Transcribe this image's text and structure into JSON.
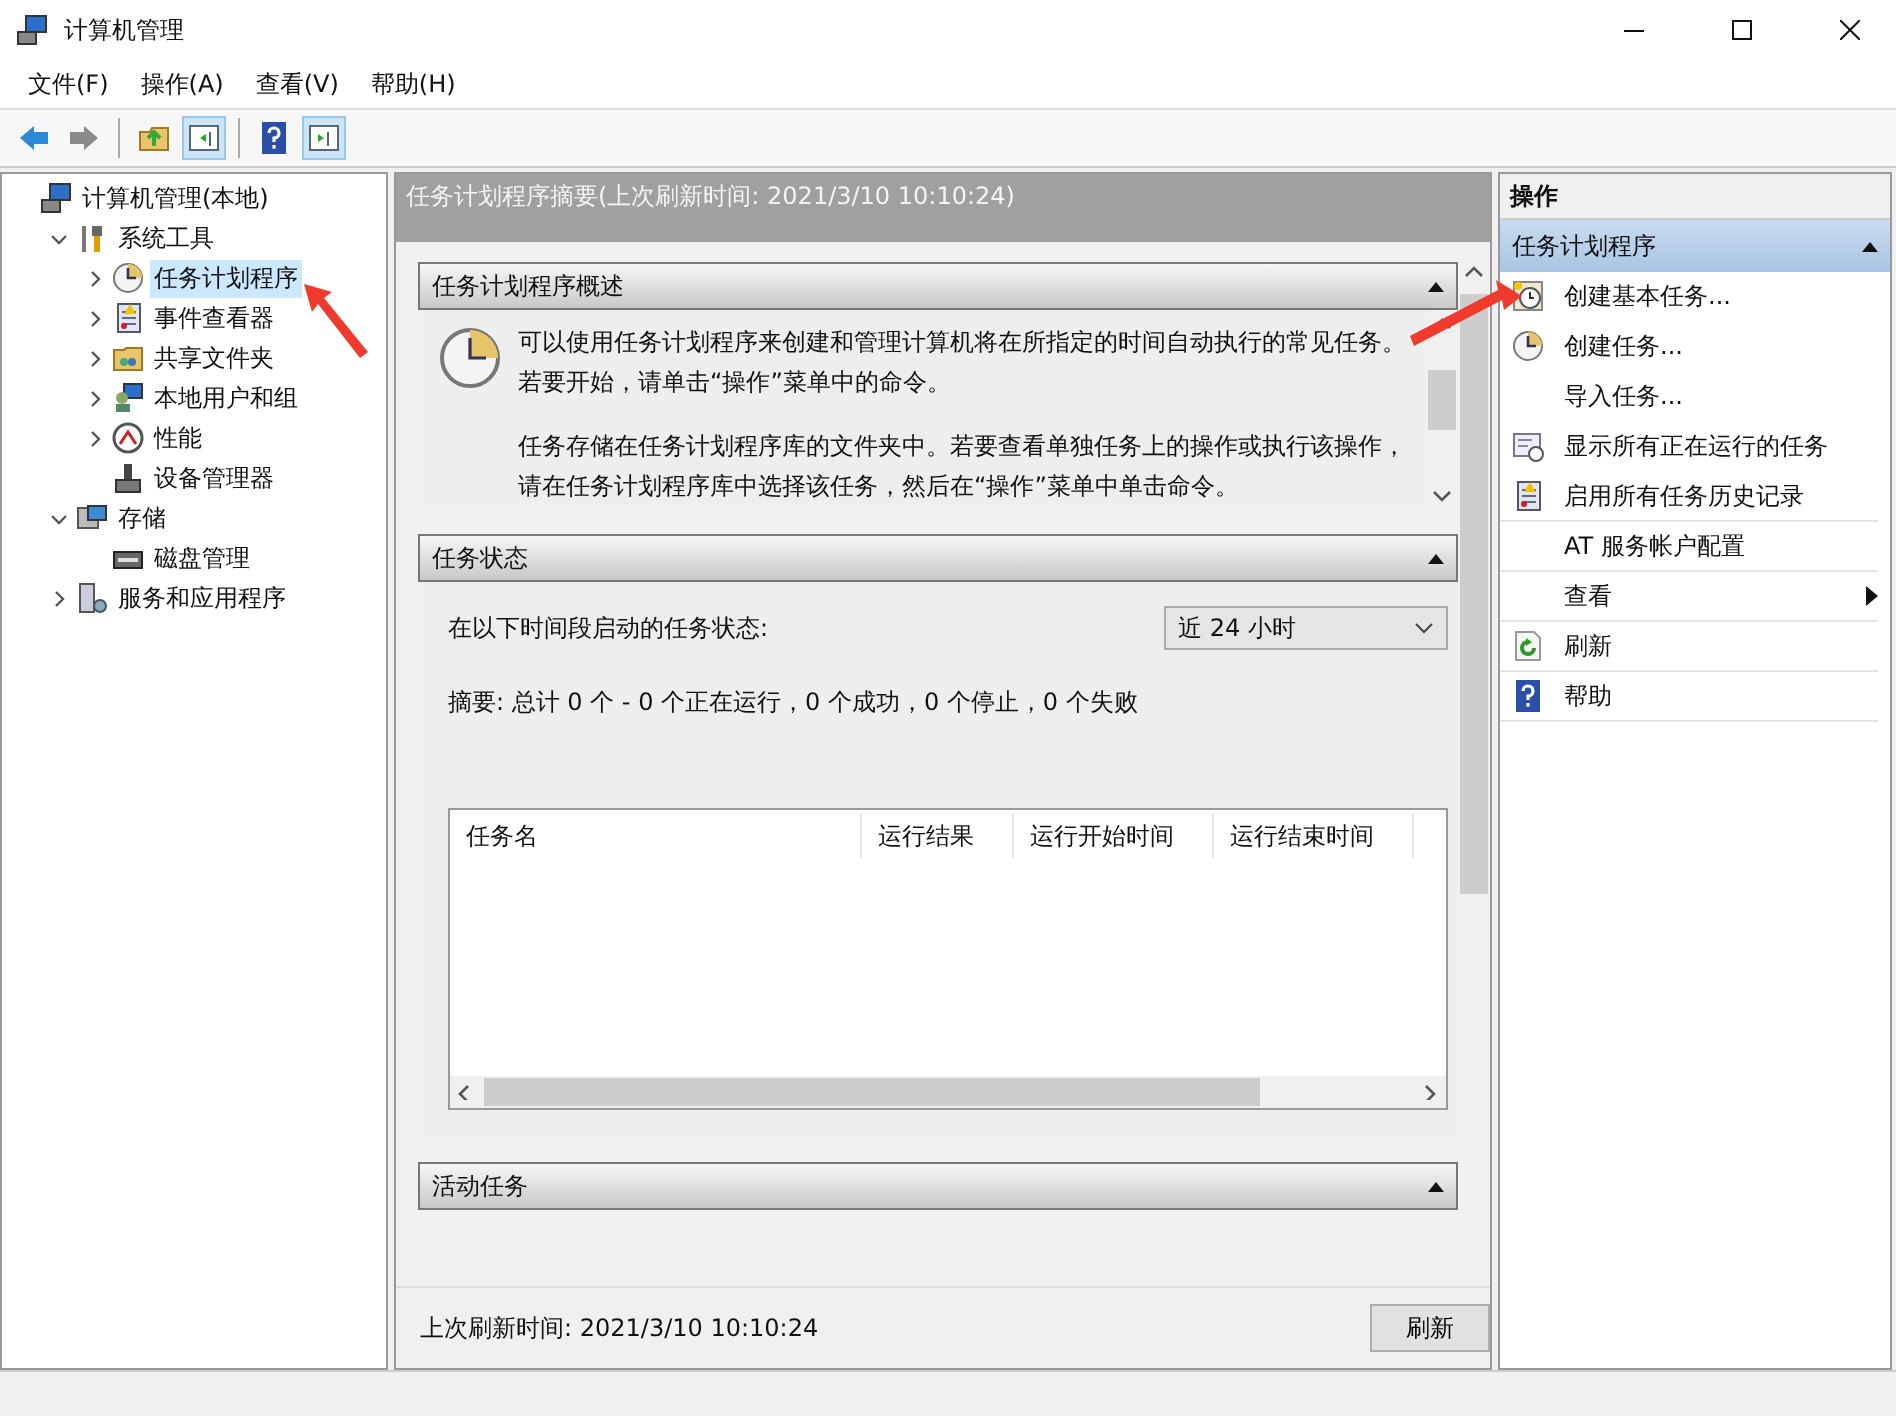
{
  "window": {
    "title": "计算机管理"
  },
  "menu": [
    "文件(F)",
    "操作(A)",
    "查看(V)",
    "帮助(H)"
  ],
  "toolbar": [
    {
      "kind": "back",
      "pressed": false
    },
    {
      "kind": "forward",
      "pressed": false
    },
    {
      "kind": "up",
      "pressed": false
    },
    {
      "kind": "tree",
      "pressed": true
    },
    {
      "kind": "help",
      "pressed": false
    },
    {
      "kind": "pane",
      "pressed": true
    }
  ],
  "tree": [
    {
      "label": "计算机管理(本地)",
      "kind": "computer",
      "selected": false,
      "children": [
        {
          "label": "系统工具",
          "kind": "tools",
          "expanded": true,
          "selected": false,
          "children": [
            {
              "label": "任务计划程序",
              "kind": "clock",
              "expanded": false,
              "selected": true
            },
            {
              "label": "事件查看器",
              "kind": "log",
              "expanded": false,
              "selected": false
            },
            {
              "label": "共享文件夹",
              "kind": "folder",
              "expanded": false,
              "selected": false
            },
            {
              "label": "本地用户和组",
              "kind": "users",
              "expanded": false,
              "selected": false
            },
            {
              "label": "性能",
              "kind": "gauge",
              "expanded": false,
              "selected": false
            },
            {
              "label": "设备管理器",
              "kind": "device",
              "selected": false
            }
          ]
        },
        {
          "label": "存储",
          "kind": "storage",
          "expanded": true,
          "selected": false,
          "children": [
            {
              "label": "磁盘管理",
              "kind": "disk",
              "selected": false
            }
          ]
        },
        {
          "label": "服务和应用程序",
          "kind": "services",
          "expanded": false,
          "selected": false
        }
      ]
    }
  ],
  "center": {
    "title": "任务计划程序摘要(上次刷新时间: 2021/3/10 10:10:24)",
    "overview": {
      "title": "任务计划程序概述",
      "paragraphs": [
        "可以使用任务计划程序来创建和管理计算机将在所指定的时间自动执行的常见任务。若要开始，请单击“操作”菜单中的命令。",
        "任务存储在任务计划程序库的文件夹中。若要查看单独任务上的操作或执行该操作，请在任务计划程序库中选择该任务，然后在“操作”菜单中单击命令。"
      ]
    },
    "status": {
      "title": "任务状态",
      "period_label": "在以下时间段启动的任务状态:",
      "period": "近 24 小时",
      "summary": "摘要: 总计 0 个 - 0 个正在运行，0 个成功，0 个停止，0 个失败",
      "columns": [
        "任务名",
        "运行结果",
        "运行开始时间",
        "运行结束时间"
      ]
    },
    "active": {
      "title": "活动任务"
    },
    "footer": {
      "text": "上次刷新时间: 2021/3/10 10:10:24",
      "button": "刷新"
    }
  },
  "actions": {
    "title": "操作",
    "section": "任务计划程序",
    "items": [
      {
        "label": "创建基本任务...",
        "kind": "basic-task",
        "submenu": false
      },
      {
        "label": "创建任务...",
        "kind": "task",
        "submenu": false
      },
      {
        "label": "导入任务...",
        "kind": "plain",
        "submenu": false
      },
      {
        "label": "显示所有正在运行的任务",
        "kind": "running",
        "submenu": false
      },
      {
        "label": "启用所有任务历史记录",
        "kind": "history",
        "submenu": false
      },
      {
        "label": "AT 服务帐户配置",
        "kind": "plain",
        "submenu": false
      },
      {
        "label": "查看",
        "kind": "plain",
        "submenu": true
      },
      {
        "label": "刷新",
        "kind": "refresh",
        "submenu": false
      },
      {
        "label": "帮助",
        "kind": "help",
        "submenu": false
      }
    ]
  }
}
